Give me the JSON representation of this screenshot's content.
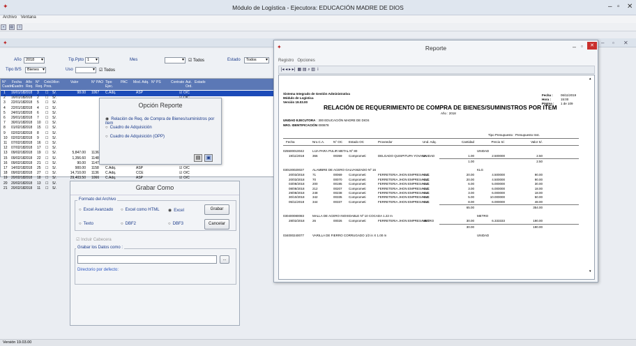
{
  "app": {
    "title": "Módulo de Logística - Ejecutora: EDUCACIÓN MADRE DE DIOS",
    "menu": [
      "Archivo",
      "Ventana"
    ],
    "status": "Versión 19.03.00"
  },
  "child": {
    "title": "Listado de Cuadro de Adquisición"
  },
  "filters": {
    "anio_label": "Año",
    "anio": "2018",
    "tippto_label": "Tip.Ppto",
    "tippto": "1",
    "mes_label": "Mes",
    "todos1": "Todos",
    "estado_label": "Estado",
    "estado": "Todos",
    "tipobs_label": "Tipo B/S",
    "tipobs": "Bienes",
    "uso_label": "Uso",
    "todos2": "Todos"
  },
  "grid": {
    "headers": [
      "N° Cuadro",
      "Fecha Cuadro",
      "Año Req.",
      "N° Req.",
      "Créd. Pres.",
      "Mon",
      "Valor",
      "N° PAO",
      "Tipo Ejec.",
      "PAC",
      "Mod. Adq.",
      "N° PS",
      "Contrato",
      "Aut. Ord.",
      "Estado"
    ],
    "rows": [
      {
        "n": "1",
        "fecha": "16/01/18",
        "anio": "2018",
        "req": "3",
        "mon": "S/.",
        "valor": "98.00",
        "pao": "1067",
        "tipo": "C.Adq.",
        "mod": "ASP",
        "ord": "O/C"
      },
      {
        "n": "2",
        "fecha": "16/01/18",
        "anio": "2018",
        "req": "2",
        "mon": "S/.",
        "valor": "",
        "pao": "",
        "tipo": "",
        "mod": "",
        "ord": "O/C"
      },
      {
        "n": "3",
        "fecha": "22/01/18",
        "anio": "2018",
        "req": "5",
        "mon": "S/.",
        "valor": "",
        "pao": "",
        "tipo": "",
        "mod": "",
        "ord": "O/C"
      },
      {
        "n": "4",
        "fecha": "22/01/18",
        "anio": "2018",
        "req": "4",
        "mon": "S/.",
        "valor": "",
        "pao": "",
        "tipo": "",
        "mod": "",
        "ord": "O/C"
      },
      {
        "n": "5",
        "fecha": "24/01/18",
        "anio": "2018",
        "req": "6",
        "mon": "S/.",
        "valor": "",
        "pao": "",
        "tipo": "",
        "mod": "",
        "ord": "O/C"
      },
      {
        "n": "6",
        "fecha": "29/01/18",
        "anio": "2018",
        "req": "7",
        "mon": "S/.",
        "valor": "",
        "pao": "",
        "tipo": "",
        "mod": "",
        "ord": "O/C"
      },
      {
        "n": "7",
        "fecha": "30/01/18",
        "anio": "2018",
        "req": "10",
        "mon": "S/.",
        "valor": "",
        "pao": "",
        "tipo": "",
        "mod": "",
        "ord": "O/C"
      },
      {
        "n": "8",
        "fecha": "01/02/18",
        "anio": "2018",
        "req": "15",
        "mon": "S/.",
        "valor": "",
        "pao": "",
        "tipo": "",
        "mod": "",
        "ord": "O/C"
      },
      {
        "n": "9",
        "fecha": "02/02/18",
        "anio": "2018",
        "req": "8",
        "mon": "S/.",
        "valor": "",
        "pao": "",
        "tipo": "",
        "mod": "",
        "ord": "O/C"
      },
      {
        "n": "10",
        "fecha": "02/02/18",
        "anio": "2018",
        "req": "9",
        "mon": "S/.",
        "valor": "",
        "pao": "",
        "tipo": "",
        "mod": "",
        "ord": "O/C"
      },
      {
        "n": "11",
        "fecha": "07/02/18",
        "anio": "2018",
        "req": "16",
        "mon": "S/.",
        "valor": "",
        "pao": "",
        "tipo": "",
        "mod": "",
        "ord": "O/C"
      },
      {
        "n": "12",
        "fecha": "07/02/18",
        "anio": "2018",
        "req": "17",
        "mon": "S/.",
        "valor": "",
        "pao": "",
        "tipo": "",
        "mod": "",
        "ord": "O/C"
      },
      {
        "n": "13",
        "fecha": "09/02/18",
        "anio": "2018",
        "req": "19",
        "mon": "S/.",
        "valor": "5,847.00",
        "pao": "1136",
        "tipo": "C.Adq.",
        "mod": "ASP",
        "ord": "O/C"
      },
      {
        "n": "15",
        "fecha": "09/02/18",
        "anio": "2018",
        "req": "22",
        "mon": "S/.",
        "valor": "1,356.60",
        "pao": "1148",
        "tipo": "C.Adq.",
        "mod": "ASP",
        "ord": "O/C"
      },
      {
        "n": "16",
        "fecha": "09/02/18",
        "anio": "2018",
        "req": "21",
        "mon": "S/.",
        "valor": "90.00",
        "pao": "1147",
        "tipo": "C.Adq.",
        "mod": "ASP",
        "ord": "O/C"
      },
      {
        "n": "17",
        "fecha": "14/02/18",
        "anio": "2018",
        "req": "25",
        "mon": "S/.",
        "valor": "900.00",
        "pao": "1158",
        "tipo": "C.Adq.",
        "mod": "ASP",
        "ord": "O/C"
      },
      {
        "n": "18",
        "fecha": "09/02/18",
        "anio": "2018",
        "req": "27",
        "mon": "S/.",
        "valor": "14,710.00",
        "pao": "1136",
        "tipo": "C.Adq.",
        "mod": "CCE",
        "ord": "O/C"
      },
      {
        "n": "19",
        "fecha": "20/02/18",
        "anio": "2018",
        "req": "18",
        "mon": "S/.",
        "valor": "29,403.50",
        "pao": "1066",
        "tipo": "C.Adq.",
        "mod": "ASP",
        "ord": "O/C"
      },
      {
        "n": "20",
        "fecha": "20/02/18",
        "anio": "2018",
        "req": "13",
        "mon": "S/.",
        "valor": "29,127.00",
        "pao": "1065",
        "tipo": "C.Adq.",
        "mod": "ASP",
        "ord": "O/C"
      },
      {
        "n": "21",
        "fecha": "20/02/18",
        "anio": "2018",
        "req": "11",
        "mon": "S/.",
        "valor": "26,411.20",
        "pao": "1063",
        "tipo": "C.Adq.",
        "mod": "ASP",
        "ord": "O/C"
      }
    ]
  },
  "opcion": {
    "title": "Opción Reporte",
    "options": [
      "Relación de Req. de Compra de Bienes/suministros por item",
      "Cuadro de Adquisición",
      "Cuadro de Adquisición (OPP)"
    ]
  },
  "grabar": {
    "title": "Grabar Como",
    "formato_label": "Formato del Archivo",
    "opts": [
      "Excel Avanzado",
      "Excel como HTML",
      "Excel",
      "Texto",
      "DBF2",
      "DBF3"
    ],
    "grabar_btn": "Grabar",
    "cancelar_btn": "Cancelar",
    "incluir": "Incluir Cabecera",
    "datos_label": "Grabar los Datos como :",
    "path_placeholder": "",
    "dir": "Directorio por defecto:"
  },
  "reporte": {
    "title": "Reporte",
    "menu": [
      "Registro",
      "Opciones"
    ],
    "sys": "Sistema Integrado de Gestión Administrativa",
    "mod": "Módulo de Logística",
    "ver": "Versión 19.03.00",
    "fecha_l": "Fecha :",
    "fecha": "06/11/2019",
    "hora_l": "Hora :",
    "hora": "15:00",
    "pag_l": "Página :",
    "pag": "1 de 109",
    "heading": "RELACIÓN DE REQUERIMIENTO DE COMPRA DE BIENES/SUMINISTROS POR ITEM",
    "anio": "Año : 2018",
    "ue_l": "UNIDAD EJECUTORA",
    "ue": ": 300   EDUCACIÓN MADRE DE DIOS",
    "nrg_l": "NRO. IDENTIFICACIÓN",
    "nrg": ": 000878",
    "presup": "Tipo Presupuesto : Presupuesto Inst.",
    "cols": [
      "Fecha",
      "Nro.C.A.",
      "N° OC",
      "Estado OC",
      "Proveedor",
      "Und. Adq.",
      "Cantidad",
      "Precio S/.",
      "Valor S/."
    ],
    "items": [
      {
        "code": "025500010042",
        "name": "LIJA PARA PULIR METAL Nº 80",
        "und": "UNIDAD",
        "rows": [
          [
            "19/11/2018",
            "366",
            "00359",
            "Comprometi",
            "DELGADO QUISPITUPA YOVANA",
            "UNIDAD",
            "1.00",
            "2.500000",
            "2.50"
          ]
        ],
        "tq": "1.00",
        "tv": "2.50"
      },
      {
        "code": "030100020027",
        "name": "ALAMBRE DE ACERO GALVANIZADO Nº 16",
        "und": "KLG",
        "rows": [
          [
            "20/03/2018",
            "71",
            "00069",
            "Comprometi",
            "FERRETERIA JHON EMPRESA INC",
            "KLG",
            "20.00",
            "4.500000",
            "90.00"
          ],
          [
            "20/03/2018",
            "70",
            "00070",
            "Comprometi",
            "FERRETERIA JHON EMPRESA INC",
            "KLG",
            "20.00",
            "4.500000",
            "90.00"
          ],
          [
            "03/08/2018",
            "200",
            "00195",
            "Comprometi",
            "FERRETERIA JHON EMPRESA INC",
            "KLG",
            "6.00",
            "5.000000",
            "30.00"
          ],
          [
            "08/08/2018",
            "212",
            "00207",
            "Comprometi",
            "FERRETERIA JHON EMPRESA INC",
            "KLG",
            "3.00",
            "6.000000",
            "18.00"
          ],
          [
            "29/08/2018",
            "248",
            "00238",
            "Comprometi",
            "FERRETERIA JHON EMPRESA INC",
            "KLG",
            "3.00",
            "6.000000",
            "18.00"
          ],
          [
            "30/10/2018",
            "342",
            "00335",
            "Comprometi",
            "FERRETERIA JHON EMPRESA INC",
            "KLG",
            "5.00",
            "10.000000",
            "50.00"
          ],
          [
            "05/11/2018",
            "344",
            "00337",
            "Comprometi",
            "FERRETERIA JHON EMPRESA INC",
            "KLG",
            "8.00",
            "6.000000",
            "48.00"
          ]
        ],
        "tq": "65.00",
        "tv": "354.00"
      },
      {
        "code": "030400080083",
        "name": "MALLA DE ACERO INOXIDABLE Nº 10 COCADA 1.22 m",
        "und": "METRO",
        "rows": [
          [
            "28/02/2018",
            "26",
            "00026",
            "Comprometi",
            "FERRETERIA JHON EMPRESA INC",
            "METRO",
            "30.00",
            "6.333333",
            "190.00"
          ]
        ],
        "tq": "30.00",
        "tv": "190.00"
      },
      {
        "code": "034000240077",
        "name": "VARILLA DE FIERRO CORRUGADO 1/2 in X 1.00 m",
        "und": "UNIDAD",
        "rows": [],
        "tq": "",
        "tv": ""
      }
    ]
  }
}
